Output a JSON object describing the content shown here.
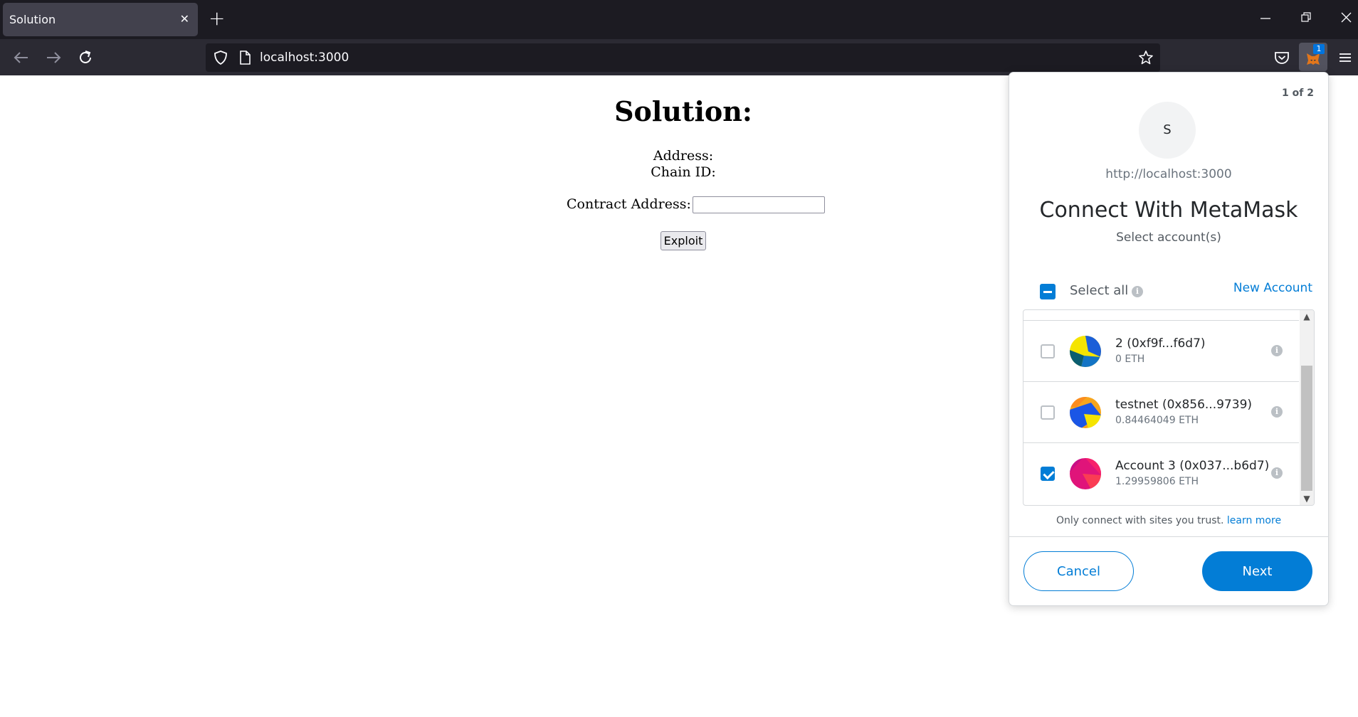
{
  "browser": {
    "tab_title": "Solution",
    "tab_close": "✕",
    "new_tab": "+",
    "url": "localhost:3000",
    "extension_badge": "1"
  },
  "page": {
    "title": "Solution:",
    "address_label": "Address:",
    "chain_id_label": "Chain ID:",
    "contract_address_label": "Contract Address:",
    "contract_address_value": "",
    "exploit_button": "Exploit"
  },
  "metamask": {
    "pager": "1 of 2",
    "site_initial": "S",
    "site_origin": "http://localhost:3000",
    "title": "Connect With MetaMask",
    "subtitle": "Select account(s)",
    "select_all": "Select all",
    "new_account": "New Account",
    "accounts": [
      {
        "name": "2 (0xf9f...f6d7)",
        "balance": "0 ETH",
        "checked": false
      },
      {
        "name": "testnet (0x856...9739)",
        "balance": "0.84464049 ETH",
        "checked": false
      },
      {
        "name": "Account 3 (0x037...b6d7)",
        "balance": "1.29959806 ETH",
        "checked": true
      }
    ],
    "trust_text": "Only connect with sites you trust.",
    "learn_more": "learn more",
    "cancel": "Cancel",
    "next": "Next"
  },
  "colors": {
    "titlebar": "#1c1b22",
    "navbar": "#2b2a33",
    "metamask_blue": "#037dd6"
  }
}
